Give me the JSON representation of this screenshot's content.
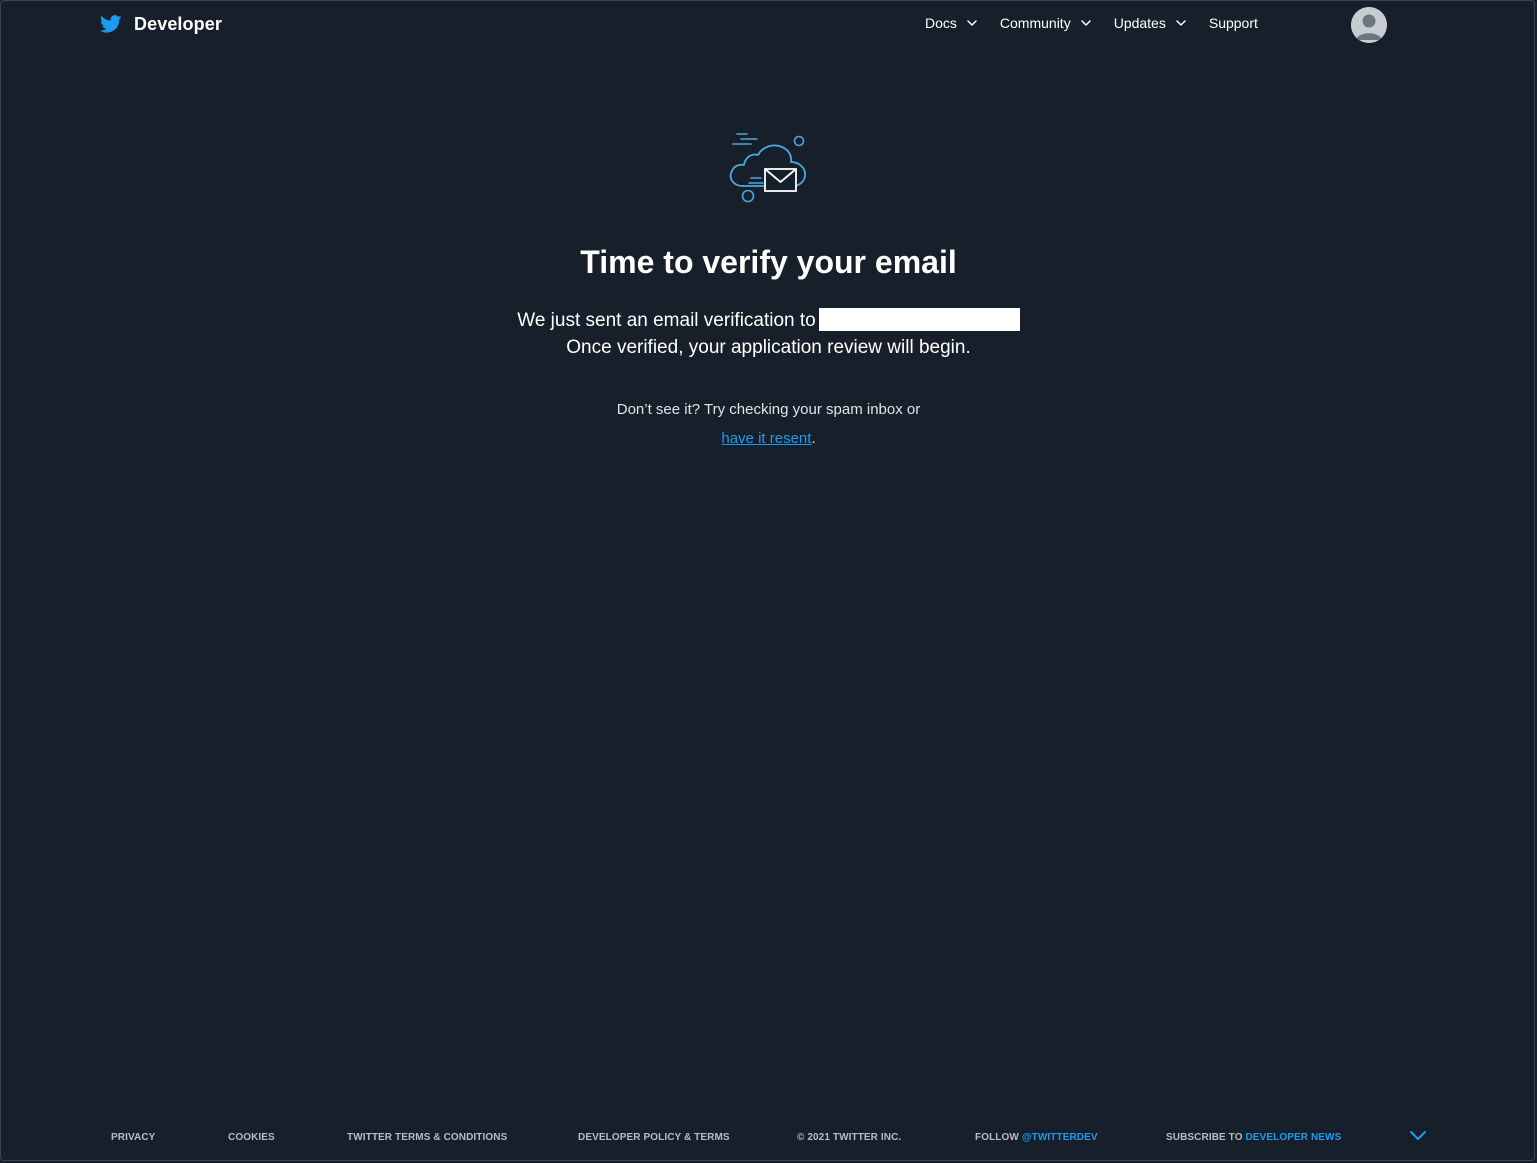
{
  "header": {
    "brand": "Developer",
    "nav": {
      "docs": "Docs",
      "community": "Community",
      "updates": "Updates",
      "support": "Support"
    }
  },
  "main": {
    "title": "Time to verify your email",
    "sent_text": "We just sent an email verification to",
    "verified_text": "Once verified, your application review will begin.",
    "spam_text": "Don’t see it? Try checking your spam inbox or",
    "resend_link": "have it resent",
    "resend_suffix": "."
  },
  "footer": {
    "privacy": "PRIVACY",
    "cookies": "COOKIES",
    "terms": "TWITTER TERMS & CONDITIONS",
    "policy": "DEVELOPER POLICY & TERMS",
    "copyright": "© 2021 TWITTER INC.",
    "follow_prefix": "FOLLOW",
    "follow_handle": "@TWITTERDEV",
    "subscribe_prefix": "SUBSCRIBE TO",
    "subscribe_link": "DEVELOPER NEWS"
  },
  "colors": {
    "background": "#17202a",
    "accent": "#1d9bf0",
    "text": "#ffffff",
    "footer_text": "#b5bcc4"
  },
  "icons": [
    "twitter-bird-icon",
    "chevron-down-icon",
    "avatar-icon",
    "cloud-email-icon"
  ]
}
